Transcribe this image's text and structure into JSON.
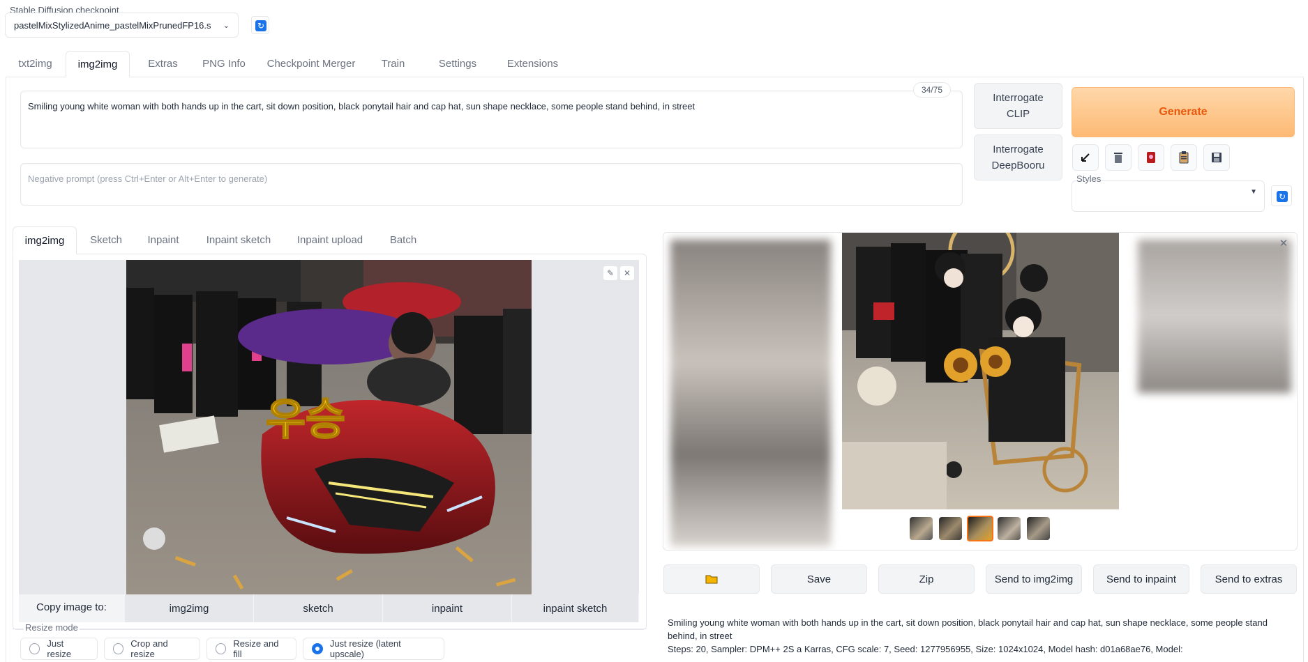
{
  "checkpoint": {
    "label": "Stable Diffusion checkpoint",
    "value": "pastelMixStylizedAnime_pastelMixPrunedFP16.s"
  },
  "top_tabs": [
    "txt2img",
    "img2img",
    "Extras",
    "PNG Info",
    "Checkpoint Merger",
    "Train",
    "Settings",
    "Extensions"
  ],
  "active_top_tab": "img2img",
  "prompt": {
    "text": "Smiling young white woman with both hands up in the cart, sit down position, black ponytail hair and cap hat, sun shape necklace, some people stand behind, in street",
    "token_count": "34/75"
  },
  "negative_prompt": {
    "placeholder": "Negative prompt (press Ctrl+Enter or Alt+Enter to generate)"
  },
  "buttons": {
    "interrogate_clip": "Interrogate CLIP",
    "interrogate_deepbooru": "Interrogate DeepBooru",
    "generate": "Generate"
  },
  "tool_icons": [
    "arrow-read-icon",
    "trash-icon",
    "model-card-icon",
    "clipboard-icon",
    "save-icon"
  ],
  "styles": {
    "label": "Styles",
    "value": ""
  },
  "sub_tabs": [
    "img2img",
    "Sketch",
    "Inpaint",
    "Inpaint sketch",
    "Inpaint upload",
    "Batch"
  ],
  "active_sub_tab": "img2img",
  "copy_image": {
    "label": "Copy image to:",
    "targets": [
      "img2img",
      "sketch",
      "inpaint",
      "inpaint sketch"
    ]
  },
  "resize_mode": {
    "label": "Resize mode",
    "options": [
      "Just resize",
      "Crop and resize",
      "Resize and fill",
      "Just resize (latent upscale)"
    ],
    "selected": "Just resize (latent upscale)"
  },
  "input_image_text": "우승",
  "output_actions": [
    "",
    "Save",
    "Zip",
    "Send to img2img",
    "Send to inpaint",
    "Send to extras"
  ],
  "generation_info": {
    "prompt": "Smiling young white woman with both hands up in the cart, sit down position, black ponytail hair and cap hat, sun shape necklace, some people stand behind, in street",
    "params": "Steps: 20, Sampler: DPM++ 2S a Karras, CFG scale: 7, Seed: 1277956955, Size: 1024x1024, Model hash: d01a68ae76, Model:"
  },
  "colors": {
    "accent": "#1a73e8",
    "generate_text": "#ea580c",
    "generate_bg": "#fdba74",
    "selected_thumb": "#f97316"
  }
}
